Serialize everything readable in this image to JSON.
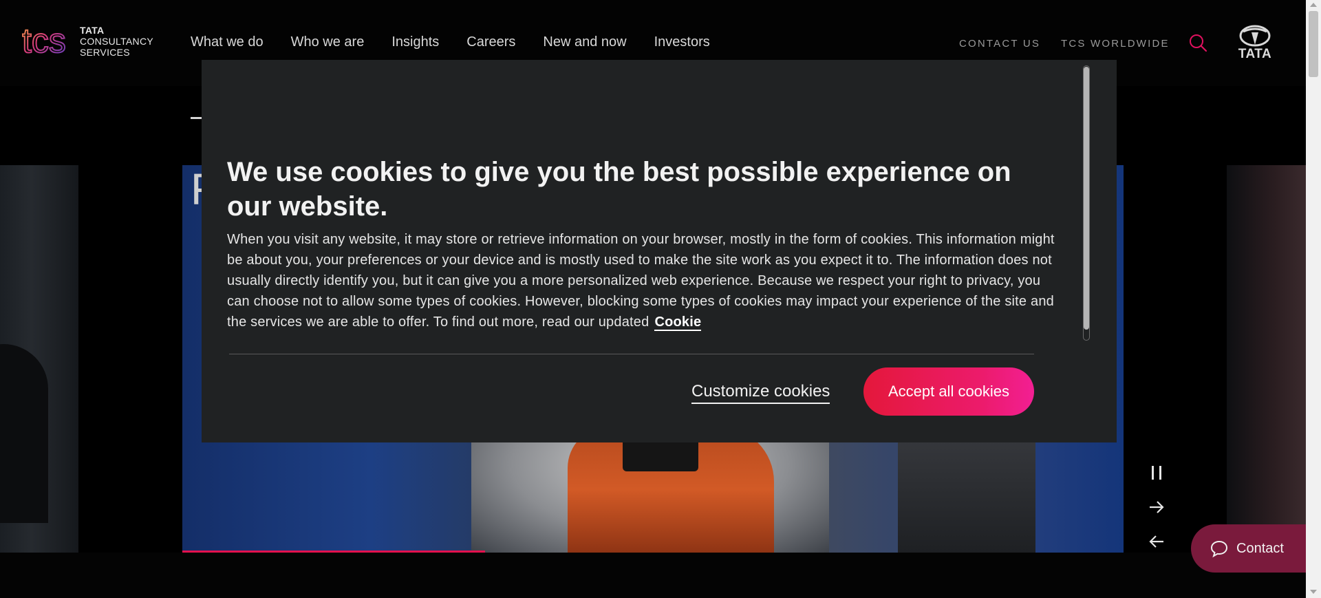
{
  "header": {
    "logo": {
      "mark": "tcs",
      "lines": [
        "TATA",
        "CONSULTANCY",
        "SERVICES"
      ]
    },
    "nav": [
      "What we do",
      "Who we are",
      "Insights",
      "Careers",
      "New and now",
      "Investors"
    ],
    "contact_us": "CONTACT US",
    "worldwide": "TCS WORLDWIDE",
    "search_icon": "search-icon",
    "brand_logo_text": "TATA"
  },
  "hero": {
    "heading_peek": "F",
    "controls": {
      "pause_icon": "pause-icon",
      "next_icon": "arrow-right-icon",
      "prev_icon": "arrow-left-icon"
    }
  },
  "contact_button": {
    "label": "Contact",
    "icon": "chat-bubble-icon"
  },
  "cookie_modal": {
    "title": "We use cookies to give you the best possible experience on our website.",
    "body": "When you visit any website, it may store or retrieve information on your browser, mostly in the form of cookies. This information might be about you, your preferences or your device and is mostly used to make the site work as you expect it to. The information does not usually directly identify you, but it can give you a more personalized web experience. Because we respect your right to privacy, you can choose not to allow some types of cookies. However, blocking some types of cookies may impact your experience of the site and the services we are able to offer. To find out more, read our updated",
    "link_label": "Cookie",
    "customize_label": "Customize cookies",
    "accept_label": "Accept all cookies"
  },
  "colors": {
    "accent_magenta": "#e4114e",
    "accept_gradient_start": "#e4183b",
    "accept_gradient_end": "#f21f93",
    "modal_bg": "#202223",
    "contact_bg": "#7a1a3c"
  }
}
